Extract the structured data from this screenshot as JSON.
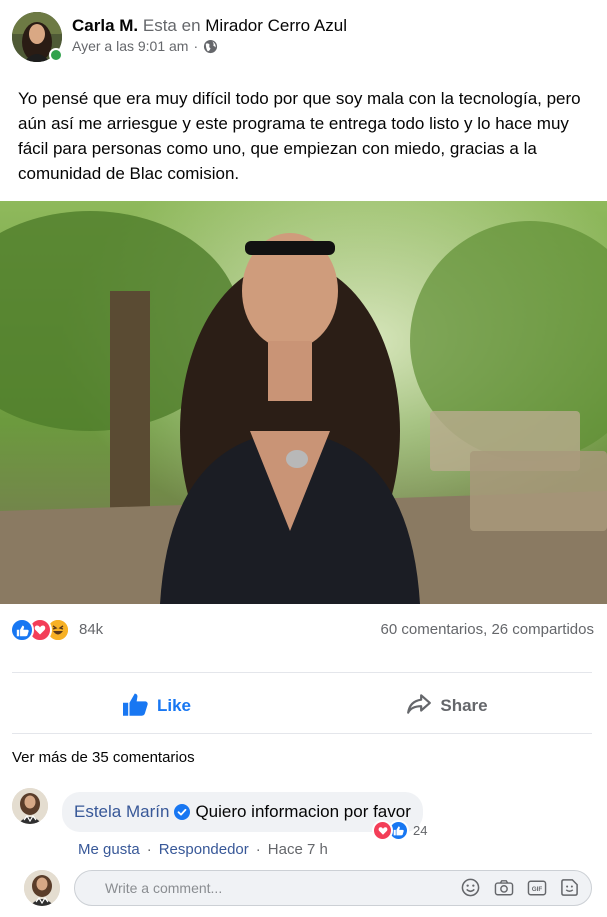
{
  "post": {
    "author": "Carla M.",
    "location_prefix": "Esta en",
    "location": "Mirador Cerro Azul",
    "timestamp": "Ayer a las 9:01 am",
    "separator": "·",
    "privacy_icon": "globe-icon",
    "text": "Yo pensé que era muy difícil todo por que soy mala con la tecnología, pero aún así me arriesgue y este programa te entrega todo listo y lo hace muy fácil para personas como uno, que empiezan con miedo, gracias a la comunidad de Blac comision."
  },
  "reactions": {
    "icons": [
      "like-icon",
      "love-icon",
      "haha-icon"
    ],
    "count": "84k",
    "comments_count": "60 comentarios",
    "shares_count": "26 compartidos",
    "counts_separator": ","
  },
  "actions": {
    "like_label": "Like",
    "share_label": "Share"
  },
  "comments": {
    "more_label": "Ver más de 35 comentarios",
    "items": [
      {
        "name": "Estela Marín",
        "verified": true,
        "text": "Quiero informacion por favor",
        "reaction_icons": [
          "love-icon",
          "like-icon"
        ],
        "reaction_count": "24",
        "like_label": "Me gusta",
        "reply_label": "Respondedor",
        "separator": "·",
        "time": "Hace 7 h"
      }
    ]
  },
  "composer": {
    "placeholder": "Write a comment...",
    "tools": [
      "emoji-icon",
      "camera-icon",
      "gif-icon",
      "sticker-icon"
    ]
  },
  "colors": {
    "brand_blue": "#1877f2",
    "link_blue": "#385898",
    "online_green": "#31a24c",
    "love_red": "#f33e58",
    "haha_yellow": "#f7b125",
    "secondary_text": "#65676b",
    "bubble_bg": "#f0f2f5"
  }
}
